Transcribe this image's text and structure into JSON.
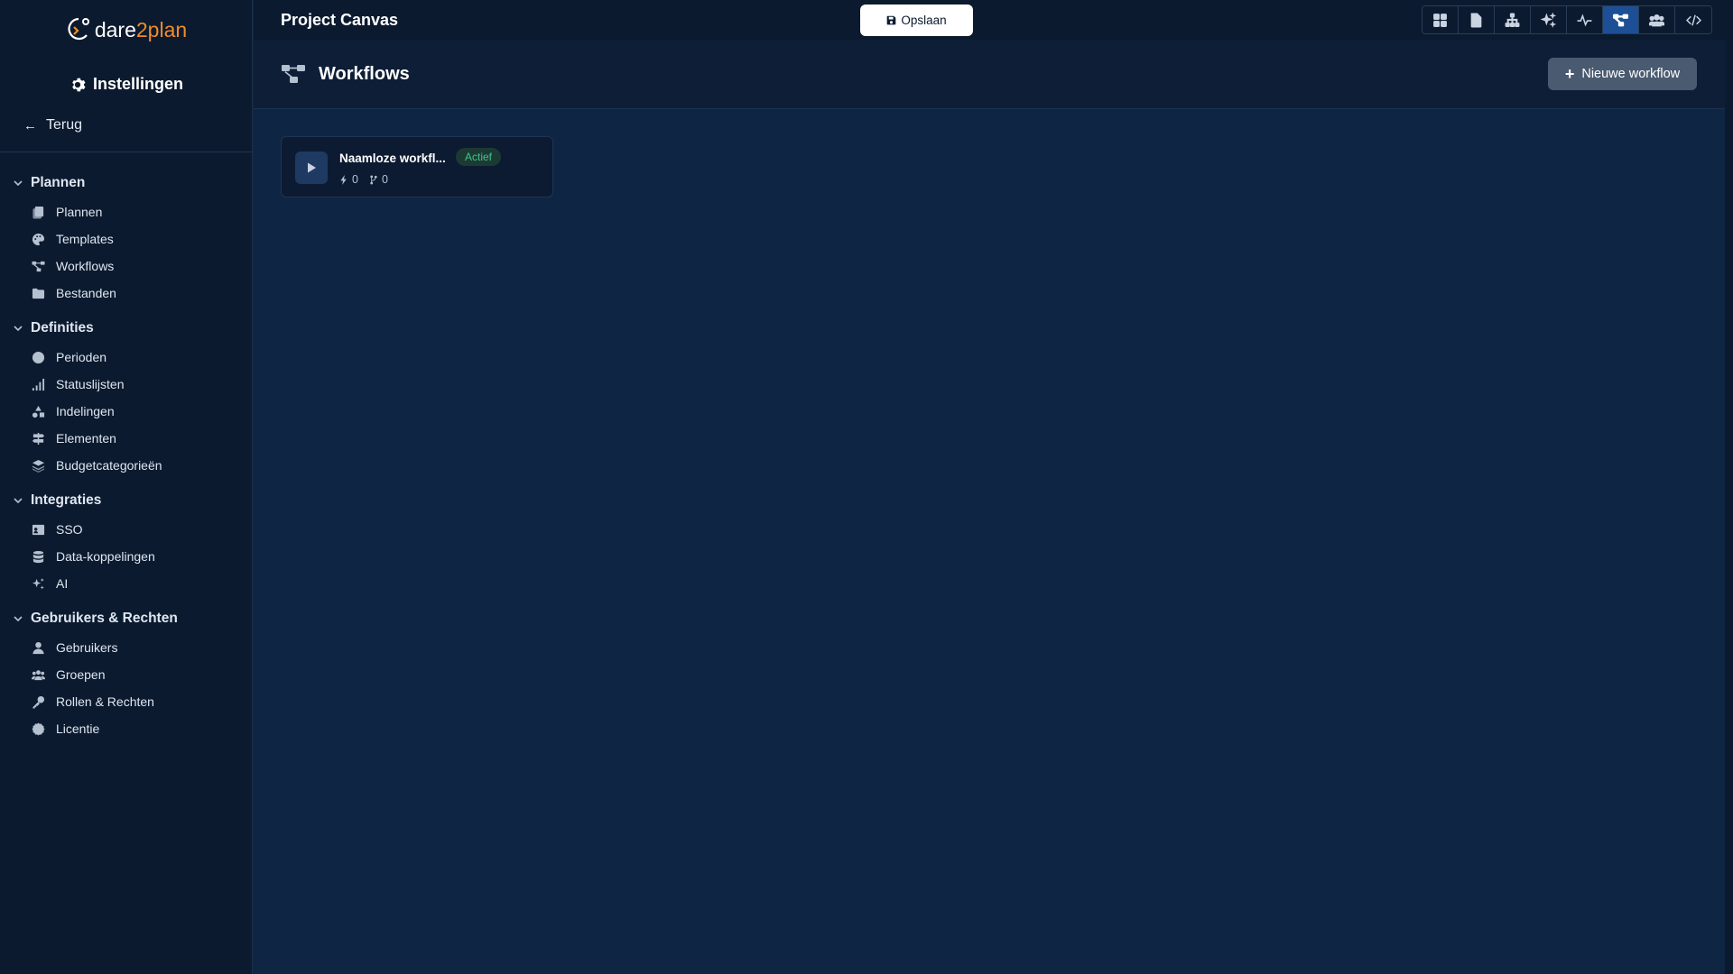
{
  "app": {
    "brand_part1": "dare",
    "brand_part2": "2plan",
    "project_title": "Project Canvas",
    "save_label": "Opslaan"
  },
  "sidebar": {
    "title": "Instellingen",
    "back_label": "Terug",
    "sections": [
      {
        "label": "Plannen",
        "items": [
          {
            "label": "Plannen",
            "icon": "copy-icon"
          },
          {
            "label": "Templates",
            "icon": "palette-icon"
          },
          {
            "label": "Workflows",
            "icon": "workflow-icon"
          },
          {
            "label": "Bestanden",
            "icon": "folder-icon"
          }
        ]
      },
      {
        "label": "Definities",
        "items": [
          {
            "label": "Perioden",
            "icon": "clock-icon"
          },
          {
            "label": "Statuslijsten",
            "icon": "signal-bars-icon"
          },
          {
            "label": "Indelingen",
            "icon": "shapes-icon"
          },
          {
            "label": "Elementen",
            "icon": "signs-icon"
          },
          {
            "label": "Budgetcategorieën",
            "icon": "layers-icon"
          }
        ]
      },
      {
        "label": "Integraties",
        "items": [
          {
            "label": "SSO",
            "icon": "id-badge-icon"
          },
          {
            "label": "Data-koppelingen",
            "icon": "database-icon"
          },
          {
            "label": "AI",
            "icon": "sparkles-icon"
          }
        ]
      },
      {
        "label": "Gebruikers & Rechten",
        "items": [
          {
            "label": "Gebruikers",
            "icon": "user-icon"
          },
          {
            "label": "Groepen",
            "icon": "users-icon"
          },
          {
            "label": "Rollen & Rechten",
            "icon": "key-icon"
          },
          {
            "label": "Licentie",
            "icon": "certificate-icon"
          }
        ]
      }
    ]
  },
  "toolbar": {
    "buttons": [
      {
        "icon": "grid-icon",
        "active": false
      },
      {
        "icon": "document-icon",
        "active": false
      },
      {
        "icon": "sitemap-icon",
        "active": false
      },
      {
        "icon": "sparkles-icon",
        "active": false
      },
      {
        "icon": "pulse-icon",
        "active": false
      },
      {
        "icon": "workflow-icon",
        "active": true
      },
      {
        "icon": "users-icon",
        "active": false
      },
      {
        "icon": "code-icon",
        "active": false
      }
    ]
  },
  "page": {
    "title": "Workflows",
    "new_button_label": "Nieuwe workflow",
    "workflows": [
      {
        "name": "Naamloze workfl...",
        "status": "Actief",
        "triggers": "0",
        "branches": "0"
      }
    ]
  },
  "colors": {
    "sidebar_bg": "#0b1a2e",
    "main_bg": "#0f2544",
    "accent": "#f28c28",
    "active_tool": "#1d4f96",
    "status_active": "#3ec58a"
  }
}
